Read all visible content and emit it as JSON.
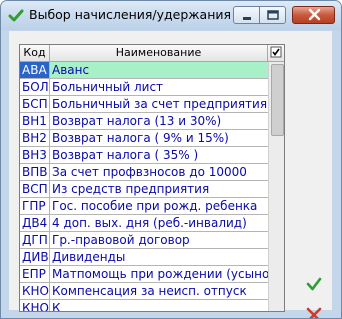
{
  "window": {
    "title": "Выбор начисления/удержания"
  },
  "table": {
    "columns": [
      "Код",
      "Наименование"
    ],
    "rows": [
      {
        "code": "АВА",
        "name": "Аванс"
      },
      {
        "code": "БОЛ",
        "name": "Больничный лист"
      },
      {
        "code": "БСП",
        "name": "Больничный за счет предприятия"
      },
      {
        "code": "ВН1",
        "name": "Возврат налога (13 и 30%)"
      },
      {
        "code": "ВН2",
        "name": "Возврат налога ( 9% и 15%)"
      },
      {
        "code": "ВН3",
        "name": "Возврат налога ( 35% )"
      },
      {
        "code": "ВПВ",
        "name": "За счет профвзносов до 10000"
      },
      {
        "code": "ВСП",
        "name": "Из средств предприятия"
      },
      {
        "code": "ГПР",
        "name": "Гос. пособие при рожд. ребенка"
      },
      {
        "code": "ДВ4",
        "name": "4 доп. вых. дня (реб.-инвалид)"
      },
      {
        "code": "ДГП",
        "name": "Гр.-правовой договор"
      },
      {
        "code": "ДИВ",
        "name": "Дивиденды"
      },
      {
        "code": "ЕПР",
        "name": "Матпомощь при рождении (усынов"
      },
      {
        "code": "КНО",
        "name": "Компенсация за неисп. отпуск"
      },
      {
        "code": "КНО",
        "name": "К"
      }
    ],
    "selected_row": 0
  },
  "icons": {
    "app": "green-checkmark-icon",
    "ok": "green-checkmark-icon",
    "cancel": "red-x-icon",
    "header_checkbox": "checkbox-icon"
  },
  "colors": {
    "selected_code_bg": "#2a64c6",
    "selected_name_bg": "#a8f0c8",
    "text": "#0a0aa8",
    "ok": "#2f9e2f",
    "cancel": "#d23a2a"
  }
}
